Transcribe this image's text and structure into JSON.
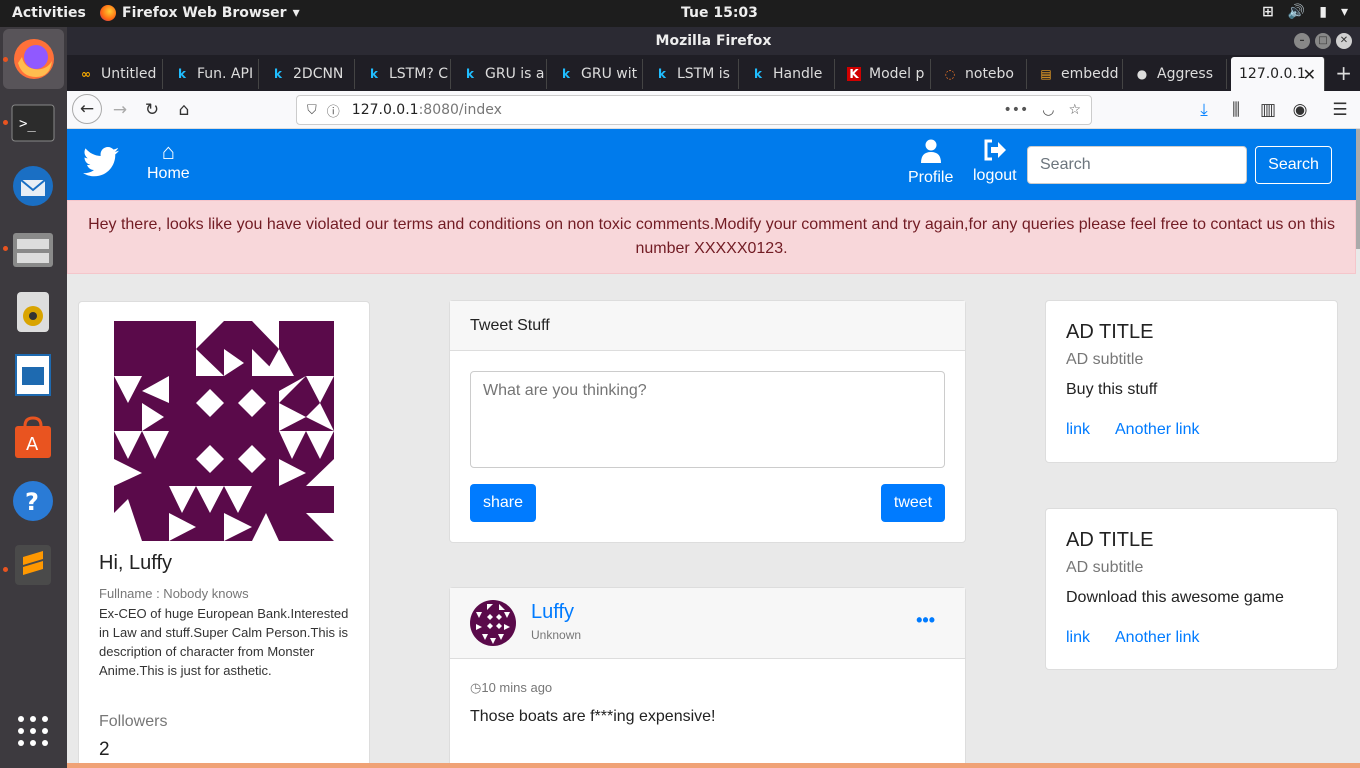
{
  "topbar": {
    "activities": "Activities",
    "app_menu": "Firefox Web Browser",
    "clock": "Tue 15:03"
  },
  "window": {
    "title": "Mozilla Firefox"
  },
  "tabs": [
    {
      "label": "Untitled",
      "icon": "colab-icon"
    },
    {
      "label": "Fun. API",
      "icon": "kaggle-icon"
    },
    {
      "label": "2DCNN",
      "icon": "kaggle-icon"
    },
    {
      "label": "LSTM? C",
      "icon": "kaggle-icon"
    },
    {
      "label": "GRU is a",
      "icon": "kaggle-icon"
    },
    {
      "label": "GRU wit",
      "icon": "kaggle-icon"
    },
    {
      "label": "LSTM is",
      "icon": "kaggle-icon"
    },
    {
      "label": "Handle",
      "icon": "kaggle-icon"
    },
    {
      "label": "Model p",
      "icon": "keras-icon"
    },
    {
      "label": "notebo",
      "icon": "jupyter-icon"
    },
    {
      "label": "embedd",
      "icon": "doc-icon"
    },
    {
      "label": "Aggress",
      "icon": "github-icon"
    },
    {
      "label": "127.0.0.1",
      "icon": "none",
      "active": true
    }
  ],
  "urlbar": {
    "host": "127.0.0.1",
    "path": ":8080/index"
  },
  "site": {
    "nav_home": "Home",
    "nav_profile": "Profile",
    "nav_logout": "logout",
    "search_placeholder": "Search",
    "search_button": "Search",
    "alert": "Hey there, looks like you have violated our terms and conditions on non toxic comments.Modify your comment and try again,for any queries please feel free to contact us on this number XXXXX0123.",
    "brand_color": "#007bec"
  },
  "profile": {
    "greeting": "Hi, Luffy",
    "fullname": "Fullname : Nobody knows",
    "bio": "Ex-CEO of huge European Bank.Interested in Law and stuff.Super Calm Person.This is description of character from Monster Anime.This is just for asthetic.",
    "followers_label": "Followers",
    "followers_count": "2",
    "identicon_color": "#5a0a4a"
  },
  "compose": {
    "header": "Tweet Stuff",
    "placeholder": "What are you thinking?",
    "share_label": "share",
    "tweet_label": "tweet"
  },
  "post": {
    "username": "Luffy",
    "location": "Unknown",
    "time": "10 mins ago",
    "text": "Those boats are f***ing expensive!"
  },
  "ads": [
    {
      "title": "AD TITLE",
      "subtitle": "AD subtitle",
      "body": "Buy this stuff",
      "link1": "link",
      "link2": "Another link"
    },
    {
      "title": "AD TITLE",
      "subtitle": "AD subtitle",
      "body": "Download this awesome game",
      "link1": "link",
      "link2": "Another link"
    }
  ]
}
